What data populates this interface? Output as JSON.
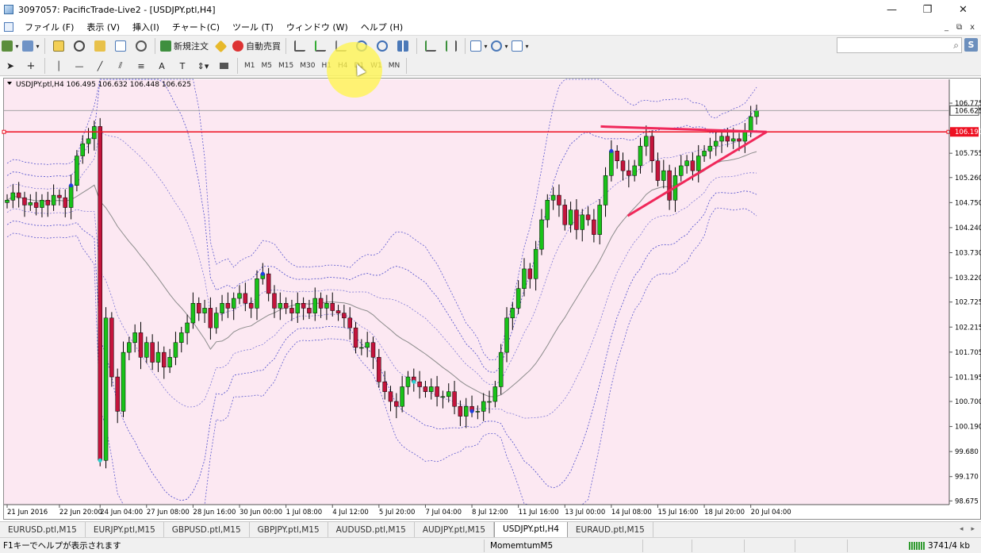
{
  "window": {
    "title": "3097057: PacificTrade-Live2 - [USDJPY.ptl,H4]",
    "controls": [
      "—",
      "❐",
      "✕"
    ]
  },
  "menu": {
    "items": [
      "ファイル (F)",
      "表示 (V)",
      "挿入(I)",
      "チャート(C)",
      "ツール (T)",
      "ウィンドウ (W)",
      "ヘルプ (H)"
    ],
    "mdi": [
      "_",
      "⧉",
      "x"
    ]
  },
  "toolbar": {
    "new_order": "新規注文",
    "auto_trade": "自動売買",
    "timeframes": [
      "M1",
      "M5",
      "M15",
      "M30",
      "H1",
      "H4",
      "D1",
      "W1",
      "MN"
    ],
    "search_placeholder": "",
    "s_button": "S"
  },
  "chart": {
    "info": "USDJPY.ptl,H4  106.495 106.632 106.448 106.625",
    "current_price_label": "106.625",
    "hline_price_label": "106.190",
    "colors": {
      "background": "#fce8f2",
      "bull": "#19c219",
      "bear": "#c4143c",
      "bands": "#4a4acb",
      "ma": "#8c8c8c",
      "hline": "#ee1122",
      "triangle": "#f0285a",
      "cyan_marker": "#2ad3d3",
      "blue_marker": "#1f3fe0"
    }
  },
  "chart_data": {
    "type": "candlestick",
    "symbol": "USDJPY.ptl",
    "timeframe": "H4",
    "y_ticks": [
      "106.775",
      "106.625",
      "106.190",
      "105.755",
      "105.260",
      "104.750",
      "104.240",
      "103.730",
      "103.220",
      "102.725",
      "102.215",
      "101.705",
      "101.195",
      "100.700",
      "100.190",
      "99.680",
      "99.170",
      "98.675"
    ],
    "y_tick_values": [
      106.775,
      106.625,
      106.19,
      105.755,
      105.26,
      104.75,
      104.24,
      103.73,
      103.22,
      102.725,
      102.215,
      101.705,
      101.195,
      100.7,
      100.19,
      99.68,
      99.17,
      98.675
    ],
    "ylim": [
      98.6,
      107.26
    ],
    "x_ticks": [
      "21 Jun 2016",
      "22 Jun 20:00",
      "24 Jun 04:00",
      "27 Jun 08:00",
      "28 Jun 16:00",
      "30 Jun 00:00",
      "1 Jul 08:00",
      "4 Jul 12:00",
      "5 Jul 20:00",
      "7 Jul 04:00",
      "8 Jul 12:00",
      "11 Jul 16:00",
      "13 Jul 00:00",
      "14 Jul 08:00",
      "15 Jul 16:00",
      "18 Jul 20:00",
      "20 Jul 04:00"
    ],
    "x_tick_bar_index": [
      0,
      9,
      16,
      24,
      32,
      40,
      48,
      56,
      64,
      72,
      80,
      88,
      96,
      104,
      112,
      120,
      128
    ],
    "closes": [
      104.8,
      104.95,
      104.85,
      104.7,
      104.75,
      104.65,
      104.8,
      104.7,
      104.9,
      104.85,
      104.65,
      105.1,
      105.7,
      105.95,
      106.05,
      106.3,
      99.5,
      102.4,
      101.2,
      100.5,
      101.7,
      101.9,
      102.1,
      101.6,
      101.9,
      101.5,
      101.7,
      101.4,
      101.6,
      101.9,
      102.1,
      102.3,
      102.7,
      102.5,
      102.6,
      102.2,
      102.5,
      102.7,
      102.6,
      102.8,
      102.9,
      102.7,
      102.6,
      103.2,
      103.3,
      102.9,
      102.6,
      102.7,
      102.6,
      102.5,
      102.7,
      102.6,
      102.5,
      102.8,
      102.6,
      102.7,
      102.55,
      102.5,
      102.4,
      102.2,
      101.8,
      101.8,
      101.9,
      101.6,
      101.1,
      100.9,
      100.7,
      100.6,
      101.0,
      101.2,
      101.1,
      101.0,
      100.9,
      101.0,
      100.8,
      100.8,
      100.9,
      100.6,
      100.4,
      100.6,
      100.5,
      100.5,
      100.7,
      100.7,
      101.0,
      101.7,
      102.4,
      102.6,
      103.0,
      103.4,
      103.2,
      103.8,
      104.4,
      104.8,
      104.9,
      104.7,
      104.3,
      104.6,
      104.2,
      104.5,
      104.4,
      104.1,
      104.7,
      105.3,
      105.8,
      105.6,
      105.4,
      105.3,
      105.5,
      105.9,
      106.1,
      105.6,
      105.2,
      105.4,
      104.8,
      105.3,
      105.5,
      105.6,
      105.4,
      105.7,
      105.8,
      105.9,
      106.0,
      106.1,
      106.0,
      106.05,
      106.0,
      106.2,
      106.5,
      106.625
    ]
  },
  "tabs": [
    "EURUSD.ptl,M15",
    "EURJPY.ptl,M15",
    "GBPUSD.ptl,M15",
    "GBPJPY.ptl,M15",
    "AUDUSD.ptl,M15",
    "AUDJPY.ptl,M15",
    "USDJPY.ptl,H4",
    "EURAUD.ptl,M15"
  ],
  "active_tab_index": 6,
  "status": {
    "help": "F1キーでヘルプが表示されます",
    "profile": "MomemtumM5",
    "traffic": "3741/4 kb"
  }
}
